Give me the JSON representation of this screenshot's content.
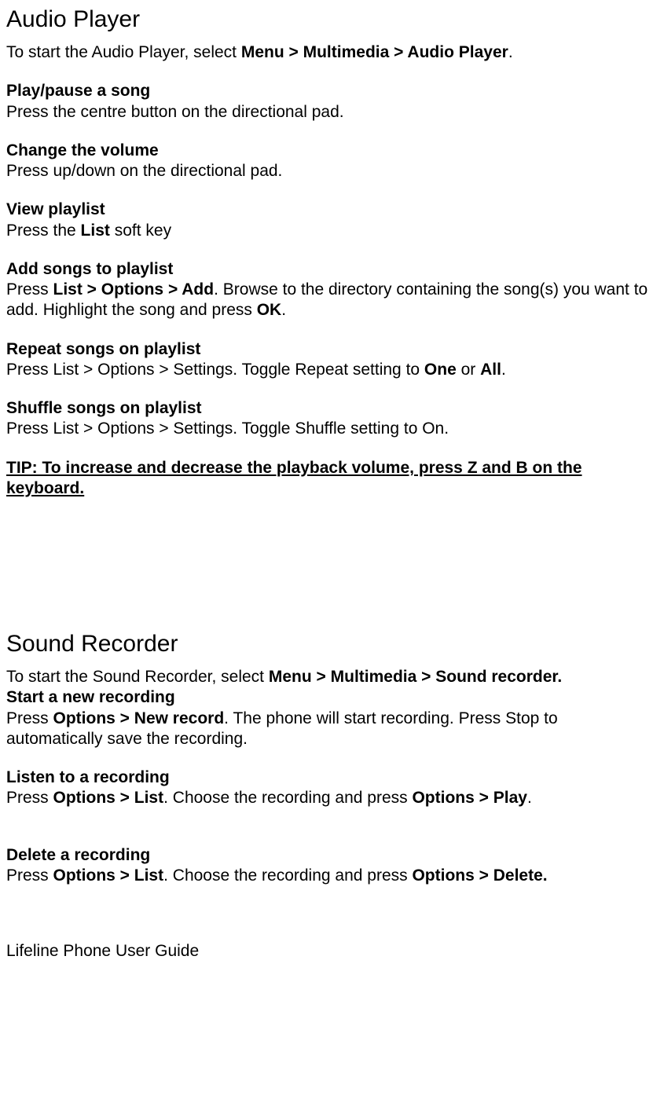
{
  "section1": {
    "heading": "Audio Player",
    "intro_pre": "To start the Audio Player, select ",
    "intro_bold": "Menu > Multimedia > Audio Player",
    "intro_post": ".",
    "playpause": {
      "label": "Play/pause a song",
      "text": "Press the centre button on the directional pad."
    },
    "volume": {
      "label": "Change the volume",
      "text": "Press up/down on the directional pad."
    },
    "viewplaylist": {
      "label": "View playlist",
      "text_pre": "Press the ",
      "text_bold": "List",
      "text_post": " soft key"
    },
    "addsongs": {
      "label": "Add songs to playlist",
      "line_pre": "Press ",
      "line_bold1": "List > Options > Add",
      "line_mid": ".  Browse to the directory containing the song(s) you want to add. Highlight the song and press ",
      "line_bold2": "OK",
      "line_post": "."
    },
    "repeat": {
      "label": "Repeat songs on playlist",
      "text_pre": "Press List > Options > Settings.  Toggle Repeat setting to ",
      "text_bold1": "One",
      "text_mid": " or ",
      "text_bold2": "All",
      "text_post": "."
    },
    "shuffle": {
      "label": "Shuffle songs on playlist",
      "text": "Press List > Options > Settings.  Toggle Shuffle setting to On."
    },
    "tip": "TIP: To increase and decrease the playback volume, press Z and B on the keyboard."
  },
  "section2": {
    "heading": "Sound Recorder",
    "intro_pre": "To start the Sound Recorder, select ",
    "intro_bold": "Menu > Multimedia > Sound recorder.",
    "start": {
      "label": "Start a new recording",
      "text_pre": "Press ",
      "text_bold": "Options > New record",
      "text_post": ". The phone will start recording.  Press Stop to automatically save the recording."
    },
    "listen": {
      "label": "Listen to a recording",
      "text_pre": "Press ",
      "text_bold1": "Options > List",
      "text_mid": ". Choose the recording and press ",
      "text_bold2": "Options > Play",
      "text_post": "."
    },
    "delete": {
      "label": "Delete a recording",
      "text_pre": "Press ",
      "text_bold1": "Options > List",
      "text_mid": ". Choose the recording and press ",
      "text_bold2": "Options > Delete."
    }
  },
  "footer": "Lifeline Phone User Guide"
}
